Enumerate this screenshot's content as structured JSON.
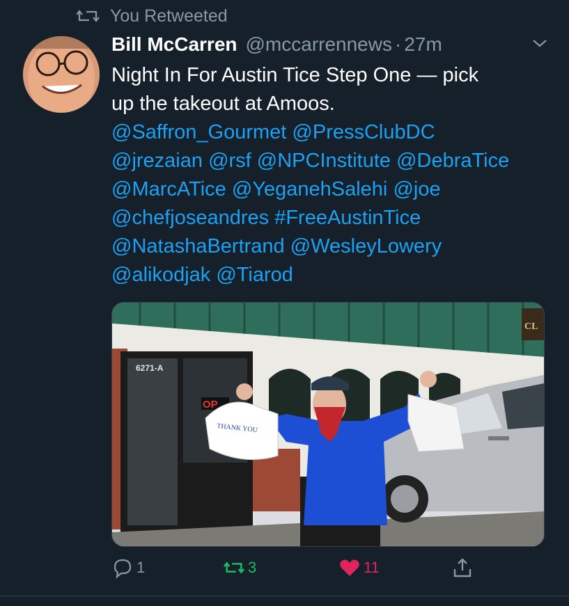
{
  "retweet_banner": {
    "label": "You Retweeted",
    "icon": "retweet-icon"
  },
  "tweet": {
    "author_name": "Bill McCarren",
    "author_handle": "@mccarrennews",
    "separator": "·",
    "time": "27m",
    "text_lines": [
      "Night In For Austin Tice Step One — pick",
      "up the takeout at Amoos."
    ],
    "mentions": [
      "@Saffron_Gourmet",
      "@PressClubDC",
      "@jrezaian",
      "@rsf",
      "@NPCInstitute",
      "@DebraTice",
      "@MarcATice",
      "@YeganehSalehi",
      "@joe",
      "@chefjoseandres",
      "#FreeAustinTice",
      "@NatashaBertrand",
      "@WesleyLowery",
      "@alikodjak",
      "@Tiarod"
    ]
  },
  "photo": {
    "store_number": "6271-A",
    "bag_text": "THANK YOU",
    "sign_fragment": "OP",
    "corner_sign": "CL"
  },
  "actions": {
    "reply_count": "1",
    "retweet_count": "3",
    "like_count": "11"
  },
  "colors": {
    "background": "#15202b",
    "link": "#1da1f2",
    "muted": "#8899a6",
    "retweet_active": "#17bf63",
    "like_active": "#e0245e"
  }
}
